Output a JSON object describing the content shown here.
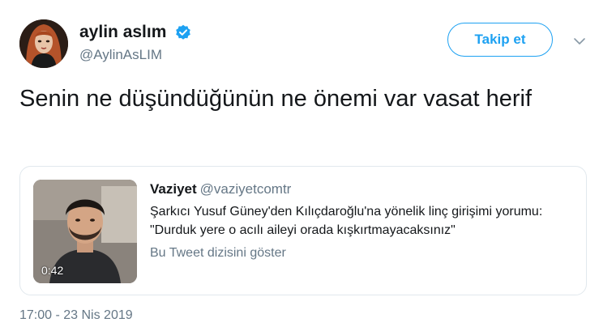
{
  "author": {
    "display_name": "aylin aslım",
    "handle": "@AylinAsLIM",
    "verified": true,
    "avatar_icon": "profile-photo"
  },
  "actions": {
    "follow_label": "Takip et",
    "more_icon": "chevron-down-icon"
  },
  "tweet": {
    "text": "Senin ne düşündüğünün ne önemi var vasat herif",
    "timestamp": "17:00 - 23 Nis 2019"
  },
  "quoted_tweet": {
    "display_name": "Vaziyet",
    "handle": "@vaziyetcomtr",
    "text": "Şarkıcı Yusuf Güney'den Kılıçdaroğlu'na yönelik linç girişimi yorumu: \"Durduk yere o acılı aileyi orada kışkırtmayacaksınız\"",
    "thread_link": "Bu Tweet dizisini göster",
    "video_duration": "0:42"
  },
  "colors": {
    "accent": "#1da1f2",
    "secondary_text": "#657786",
    "border": "#e1e8ed"
  }
}
